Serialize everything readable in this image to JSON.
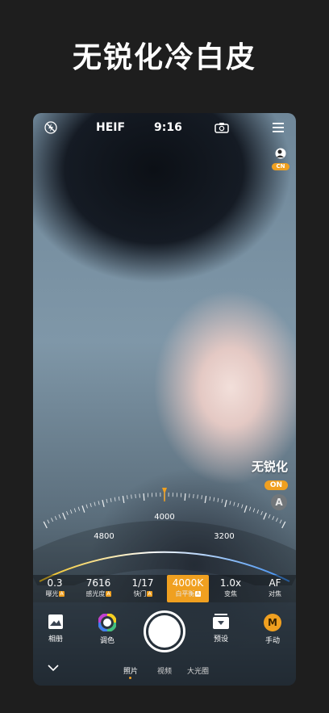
{
  "headline": "无锐化冷白皮",
  "topbar": {
    "flash_icon": "flash-off-icon",
    "format": "HEIF",
    "timer": "9:16",
    "flip_icon": "camera-flip-icon",
    "menu_icon": "menu-icon",
    "region_badge": "CN"
  },
  "overlay": {
    "sharpen_label": "无锐化",
    "sharpen_state": "ON",
    "auto_label": "A"
  },
  "dial": {
    "labels": [
      "4800",
      "4000",
      "3200"
    ],
    "current": "4000"
  },
  "params": [
    {
      "value": "0.3",
      "name": "曝光",
      "auto": "A"
    },
    {
      "value": "7616",
      "name": "感光度",
      "auto": "A"
    },
    {
      "value": "1/17",
      "name": "快门",
      "auto": "A"
    },
    {
      "value": "4000K",
      "name": "白平衡",
      "auto": "A"
    },
    {
      "value": "1.0x",
      "name": "变焦",
      "auto": ""
    },
    {
      "value": "AF",
      "name": "对焦",
      "auto": ""
    }
  ],
  "tools": {
    "album": "相册",
    "color": "调色",
    "preset": "预设",
    "manual": "手动",
    "manual_badge": "M"
  },
  "modes": [
    "照片",
    "视频",
    "大光圈"
  ],
  "colors": {
    "accent": "#f0a020",
    "background": "#1e1e1e"
  }
}
